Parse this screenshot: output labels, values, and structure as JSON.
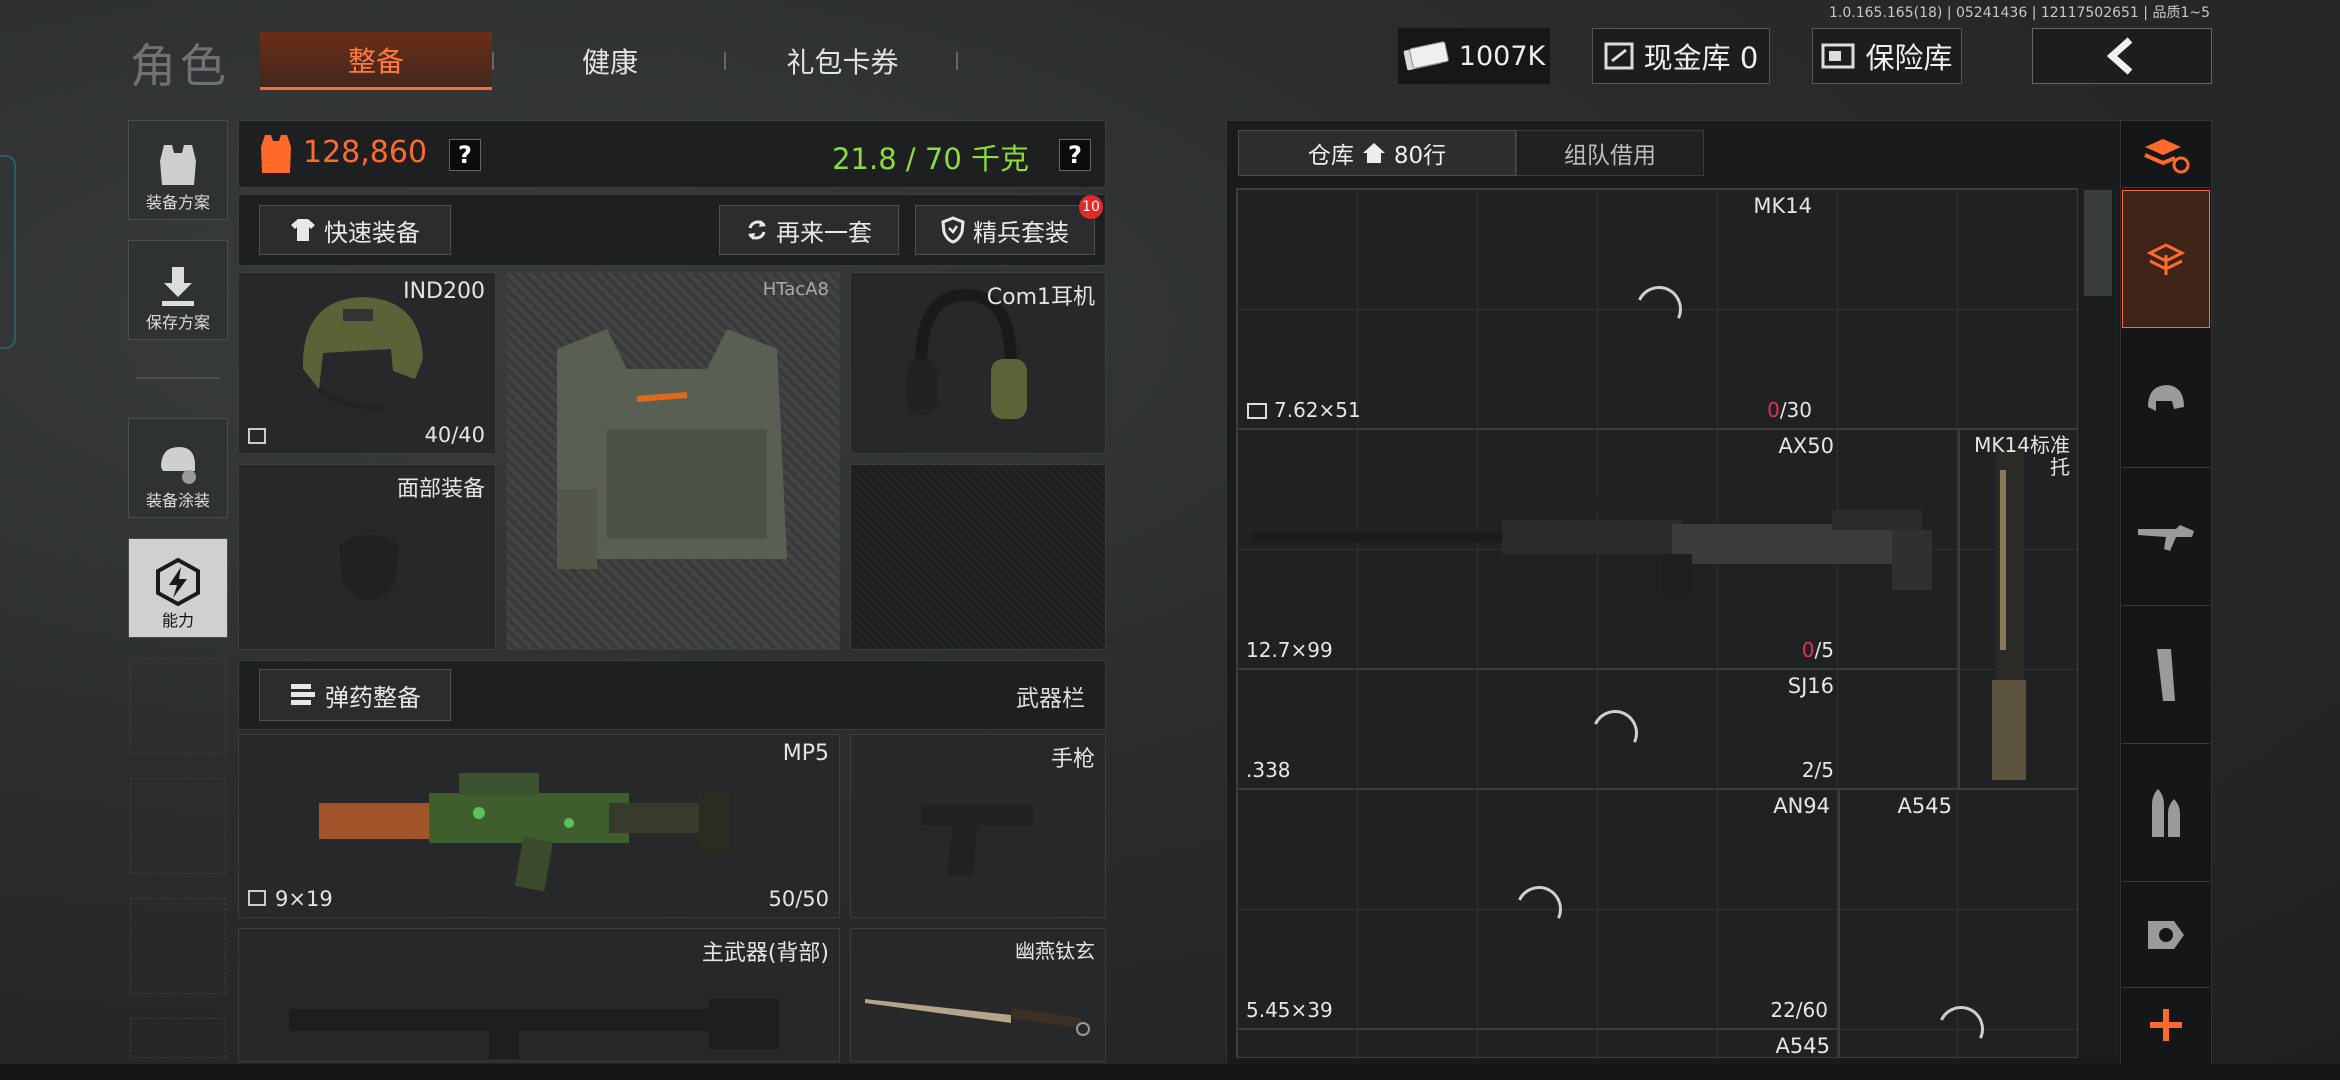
{
  "version": "1.0.165.165(18) | 05241436 | 12117502651 | 品质1~5",
  "header": {
    "title": "角色",
    "tabs": [
      "整备",
      "健康",
      "礼包卡券"
    ],
    "money": "1007K",
    "cash_vault": "现金库 0",
    "safe": "保险库"
  },
  "sidebar": {
    "items": [
      "装备方案",
      "保存方案",
      "装备涂装",
      "能力"
    ]
  },
  "panel": {
    "value": "128,860",
    "weight": "21.8 / 70 千克",
    "quick_equip": "快速装备",
    "again": "再来一套",
    "elite": "精兵套装",
    "elite_badge": "10",
    "slots": {
      "helmet": {
        "name": "IND200",
        "durability": "40/40"
      },
      "armor": {
        "name": "HTacA8"
      },
      "headset": {
        "name": "Com1耳机"
      },
      "face": {
        "name": "面部装备"
      }
    },
    "ammo_button": "弹药整备",
    "weapons_label": "武器栏",
    "mp5": {
      "name": "MP5",
      "caliber": "9×19",
      "ammo": "50/50"
    },
    "pistol": "手枪",
    "primary_back": "主武器(背部)",
    "melee": "幽燕钛玄"
  },
  "storage": {
    "tab_warehouse": "仓库",
    "rows": "80行",
    "tab_team": "组队借用",
    "items": [
      {
        "name": "MK14",
        "caliber": "7.62×51",
        "count_zero": "0",
        "count_rest": "/30"
      },
      {
        "name": "AX50",
        "caliber": "12.7×99",
        "count_zero": "0",
        "count_rest": "/5"
      },
      {
        "name": "MK14标准托"
      },
      {
        "name": "SJ16",
        "caliber": ".338",
        "count": "2/5"
      },
      {
        "name": "AN94",
        "caliber": "5.45×39",
        "count": "22/60"
      },
      {
        "name": "A545"
      },
      {
        "name": "A545"
      }
    ]
  },
  "colors": {
    "accent": "#ff6a2a",
    "weight_green": "#8ddc3a",
    "count_red": "#e0305a"
  }
}
